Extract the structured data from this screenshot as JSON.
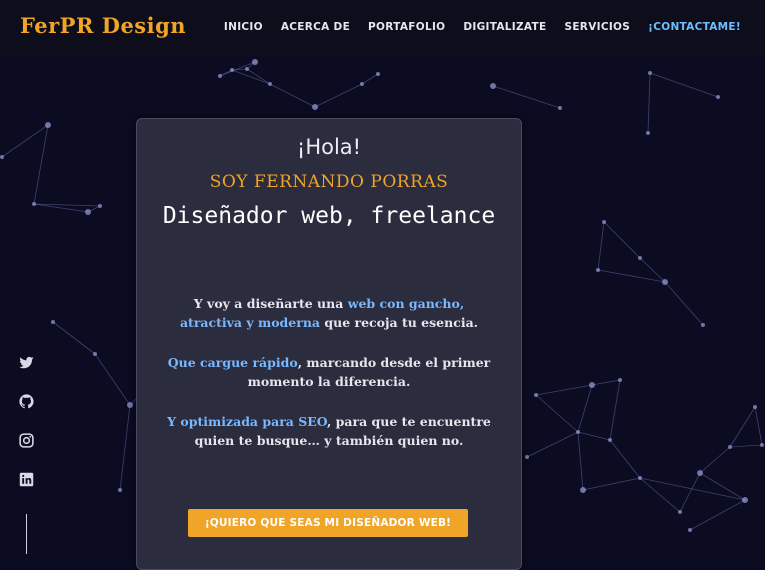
{
  "header": {
    "logo": "FerPR Design",
    "nav": [
      {
        "label": "INICIO"
      },
      {
        "label": "ACERCA DE"
      },
      {
        "label": "PORTAFOLIO"
      },
      {
        "label": "DIGITALIZATE"
      },
      {
        "label": "SERVICIOS"
      },
      {
        "label": "¡CONTACTAME!"
      }
    ]
  },
  "hero": {
    "greeting": "¡Hola!",
    "name": "SOY FERNANDO PORRAS",
    "role": "Diseñador web, freelance",
    "p1": {
      "a": "Y voy a diseñarte una ",
      "hl1": "web con gancho, atractiva y moderna",
      "b": " que recoja tu esencia."
    },
    "p2": {
      "hl": "Que cargue rápido",
      "a": ", marcando desde el primer momento la diferencia."
    },
    "p3": {
      "hl": "Y optimizada para SEO",
      "a": ", para que te encuentre quien te busque… y también quien no."
    },
    "cta": "¡QUIERO QUE SEAS MI DISEÑADOR WEB!"
  },
  "social": [
    {
      "icon": "twitter-icon"
    },
    {
      "icon": "github-icon"
    },
    {
      "icon": "instagram-icon"
    },
    {
      "icon": "linkedin-icon"
    }
  ],
  "colors": {
    "background": "#0b0b22",
    "accent": "#f0a428",
    "highlight": "#7ab8ff",
    "nav_accent": "#6cc0ff"
  }
}
